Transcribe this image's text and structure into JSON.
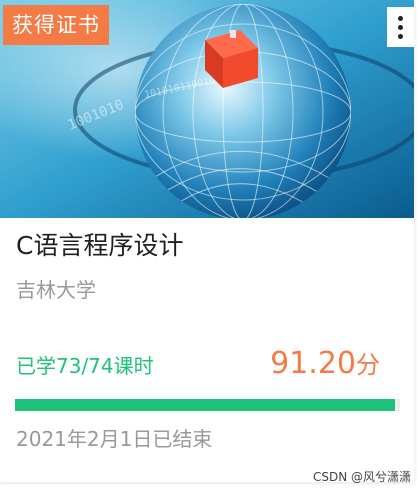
{
  "cover": {
    "badge": "获得证书",
    "more_icon": "more-vertical-icon",
    "image": "globe-cover-image"
  },
  "course": {
    "title": "C语言程序设计",
    "school": "吉林大学",
    "learned": "已学73/74课时",
    "score_value": "91.20",
    "score_unit": "分",
    "progress_fraction": 0.986,
    "end_date": "2021年2月1日已结束"
  },
  "watermark": "CSDN @风兮潇潇",
  "colors": {
    "badge": "#f47b45",
    "score": "#f47b45",
    "progress": "#1fc27a",
    "learned": "#1fc27a"
  }
}
